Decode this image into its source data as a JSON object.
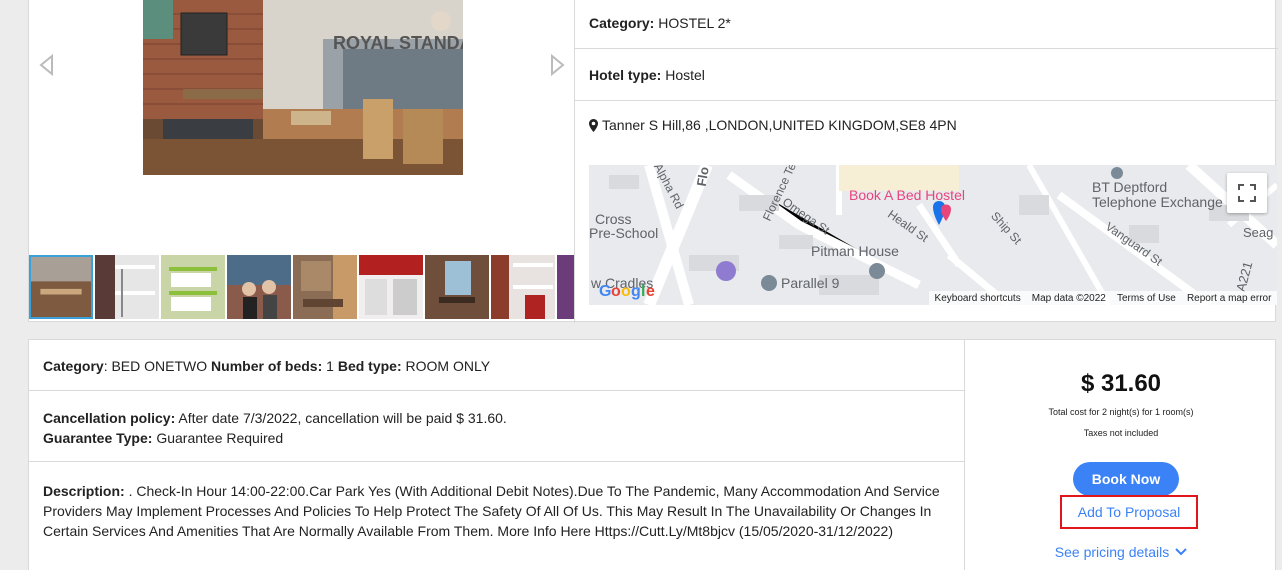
{
  "hotel": {
    "category_label": "Category:",
    "category_value": "HOSTEL 2*",
    "type_label": "Hotel type:",
    "type_value": "Hostel",
    "address": "Tanner S Hill,86 ,LONDON,UNITED KINGDOM,SE8 4PN"
  },
  "gallery": {
    "hero_sign_text": "ROYAL STANDA",
    "thumbnail_count": 9
  },
  "map": {
    "labels": {
      "hotel": "Book A Bed Hostel",
      "bt": "BT Deptford",
      "bt2": "Telephone Exchange",
      "alpha": "Alpha Rd",
      "florence": "Florence Ter",
      "omega": "Omega St",
      "heald": "Heald St",
      "ship": "Ship St",
      "vanguard": "Vanguard St",
      "pitman": "Pitman House",
      "parallel": "Parallel 9",
      "cross": "Cross",
      "preschool": "Pre-School",
      "cradles": "w Cradles",
      "a221": "A221",
      "seag": "Seag",
      "flo": "Flo"
    },
    "footer": {
      "shortcuts": "Keyboard shortcuts",
      "mapdata": "Map data ©2022",
      "terms": "Terms of Use",
      "report": "Report a map error"
    }
  },
  "room": {
    "category_label": "Category",
    "category_value": "BED ONETWO",
    "beds_label": "Number of beds:",
    "beds_value": "1",
    "bedtype_label": "Bed type:",
    "bedtype_value": "ROOM ONLY",
    "cancel_label": "Cancellation policy:",
    "cancel_value": "After date 7/3/2022, cancellation will be paid $ 31.60.",
    "guarantee_label": "Guarantee Type:",
    "guarantee_value": "Guarantee Required",
    "description_label": "Description:",
    "description_value": ". Check-In Hour 14:00-22:00.Car Park Yes (With Additional Debit Notes).Due To The Pandemic, Many Accommodation And Service Providers May Implement Processes And Policies To Help Protect The Safety Of All Of Us. This May Result In The Unavailability Or Changes In Certain Services And Amenities That Are Normally Available From Them. More Info Here Https://Cutt.Ly/Mt8bjcv (15/05/2020-31/12/2022)"
  },
  "pricing": {
    "price": "$ 31.60",
    "total_note": "Total cost for 2 night(s) for 1 room(s)",
    "tax_note": "Taxes not included",
    "book_now": "Book Now",
    "add_proposal": "Add To Proposal",
    "see_details": "See pricing details"
  },
  "colors": {
    "accent": "#3b82f6",
    "highlight_border": "#e0161b",
    "hotel_marker": "#e8457a"
  }
}
